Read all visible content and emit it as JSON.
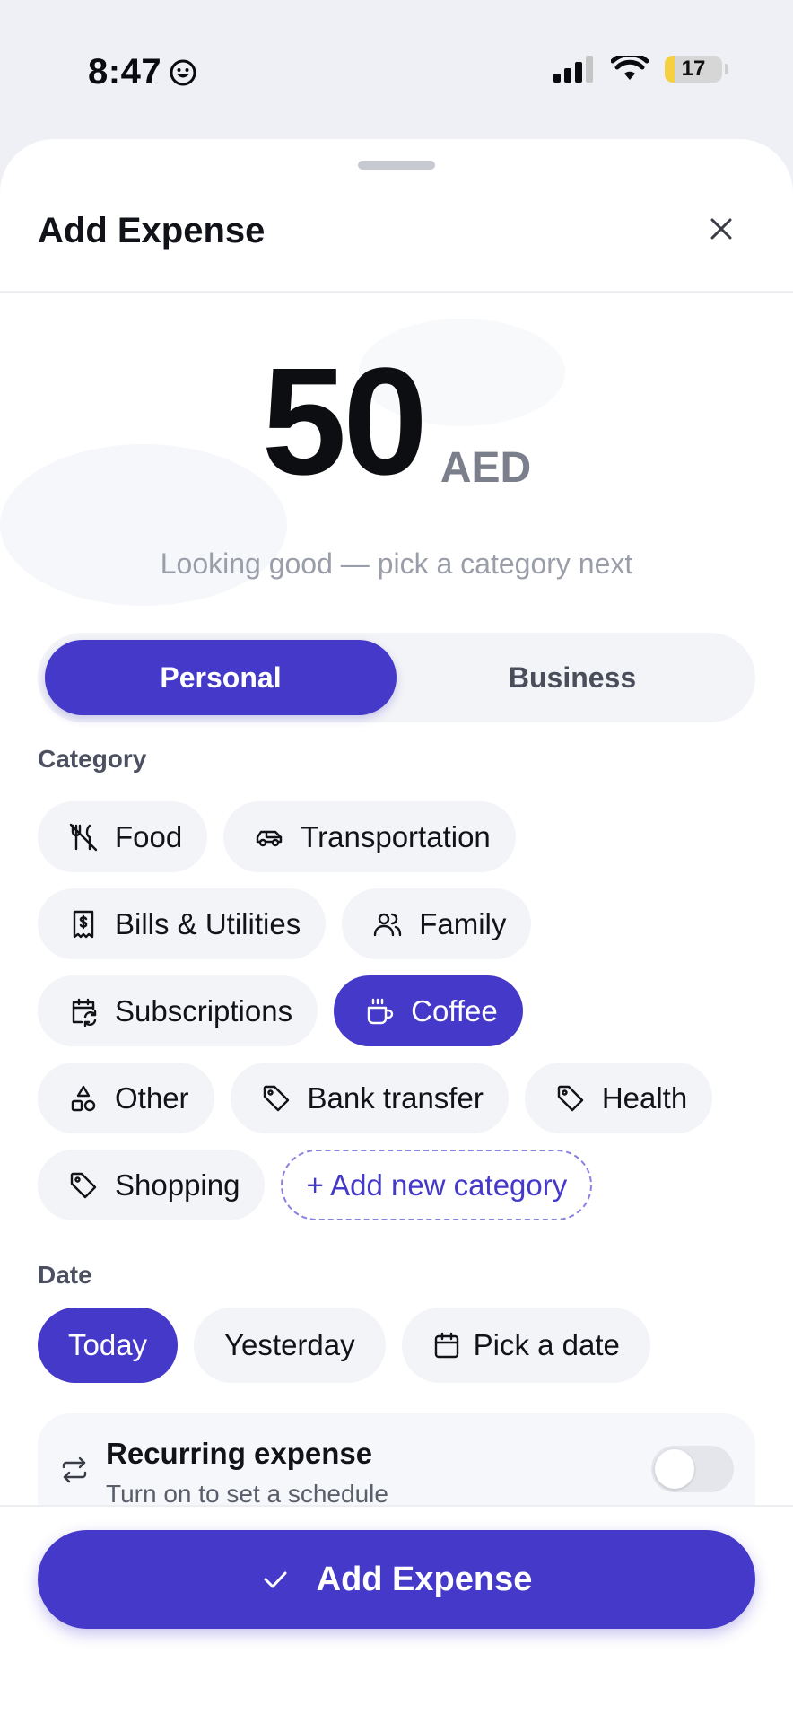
{
  "status_bar": {
    "time": "8:47",
    "battery": "17",
    "battery_level": 0.17
  },
  "sheet": {
    "title": "Add Expense",
    "amount": {
      "value": "50",
      "currency": "AED",
      "hint": "Looking good — pick a category next"
    },
    "type_toggle": {
      "options": [
        "Personal",
        "Business"
      ],
      "selected": "Personal"
    },
    "category": {
      "label": "Category",
      "items": [
        {
          "label": "Food",
          "icon": "fork-knife-off-icon"
        },
        {
          "label": "Transportation",
          "icon": "car-icon"
        },
        {
          "label": "Bills & Utilities",
          "icon": "receipt-icon"
        },
        {
          "label": "Family",
          "icon": "users-icon"
        },
        {
          "label": "Subscriptions",
          "icon": "calendar-repeat-icon"
        },
        {
          "label": "Coffee",
          "icon": "coffee-icon",
          "selected": true
        },
        {
          "label": "Other",
          "icon": "shapes-icon"
        },
        {
          "label": "Bank transfer",
          "icon": "tag-icon"
        },
        {
          "label": "Health",
          "icon": "tag-icon"
        },
        {
          "label": "Shopping",
          "icon": "tag-icon"
        }
      ],
      "add_label": "+ Add new category"
    },
    "date": {
      "label": "Date",
      "options": [
        "Today",
        "Yesterday",
        "Pick a date"
      ],
      "selected": "Today"
    },
    "recurring": {
      "title": "Recurring expense",
      "subtitle": "Turn on to set a schedule",
      "enabled": false
    },
    "submit_label": "Add Expense"
  },
  "colors": {
    "accent": "#4539C9",
    "chip_bg": "#F3F4F7",
    "text": "#111318",
    "muted": "#9A9EA9"
  }
}
